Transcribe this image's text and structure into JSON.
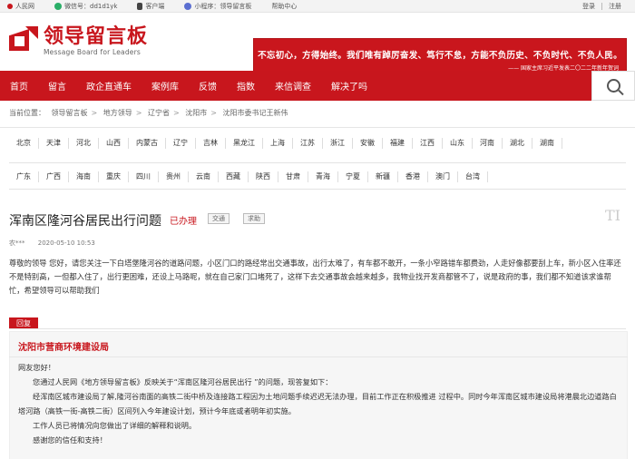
{
  "topbar": {
    "people": "人民网",
    "wechat": "微信号：dd1d1yk",
    "client": "客户端",
    "miniapp": "小程序：领导留言板",
    "help": "帮助中心",
    "login": "登录",
    "register": "注册"
  },
  "logo": {
    "cn": "领导留言板",
    "en": "Message Board for Leaders"
  },
  "banner": {
    "quote": "不忘初心，方得始终。我们唯有踔厉奋发、笃行不怠，方能不负历史、不负时代、不负人民。",
    "source": "—— 国家主席习近平发表二〇二二年新年贺词"
  },
  "nav": [
    "首页",
    "留言",
    "政企直通车",
    "案例库",
    "反馈",
    "指数",
    "来信调查",
    "解决了吗"
  ],
  "breadcrumb": [
    "当前位置：",
    "领导留言板",
    "地方领导",
    "辽宁省",
    "沈阳市",
    "沈阳市委书记王新伟"
  ],
  "provinces_row1": [
    "北京",
    "天津",
    "河北",
    "山西",
    "内蒙古",
    "辽宁",
    "吉林",
    "黑龙江",
    "上海",
    "江苏",
    "浙江",
    "安徽",
    "福建",
    "江西",
    "山东",
    "河南",
    "湖北",
    "湖南"
  ],
  "provinces_row2": [
    "广东",
    "广西",
    "海南",
    "重庆",
    "四川",
    "贵州",
    "云南",
    "西藏",
    "陕西",
    "甘肃",
    "青海",
    "宁夏",
    "新疆",
    "香港",
    "澳门",
    "台湾"
  ],
  "post": {
    "title": "浑南区隆河谷居民出行问题",
    "status": "已办理",
    "tag1": "交通",
    "tag2": "求助",
    "font_icon": "TI",
    "author": "农***",
    "time": "2020-05-10 10:53",
    "content": "尊敬的领导 您好，请您关注一下白塔堡隆河谷的道路问题，小区门口的路经常出交通事故，出行太难了，有车都不敢开，一条小窄路错车都费劲，人走好像都要刮上车，新小区入住率还不是特别高，一但都入住了，出行更困难，还设上马路呢，就在自己家门口堵死了，这样下去交通事故会越来越多，我物业找开发商都管不了，说是政府的事，我们都不知道该求谁帮忙，希望领导可以帮助我们"
  },
  "reply": {
    "tab": "回复",
    "org": "沈阳市营商环境建设局",
    "greeting": "网友您好！",
    "p1": "您通过人民网《地方领导留言板》反映关于“浑南区隆河谷居民出行 ”的问题，现答复如下：",
    "p2": "经浑南区城市建设局了解,隆河谷南面的高铁二街中桥及连接路工程因为土地问题手续迟迟无法办理，目前工作正在积极推进 过程中。同时今年浑南区城市建设局将港晨北边道路白塔河路（高铁一街-高铁二街）区间列入今年建设计划，预计今年底或者明年初实施。",
    "p3": "工作人员已将情况向您做出了详细的解释和说明。",
    "p4": "感谢您的信任和支持！"
  }
}
